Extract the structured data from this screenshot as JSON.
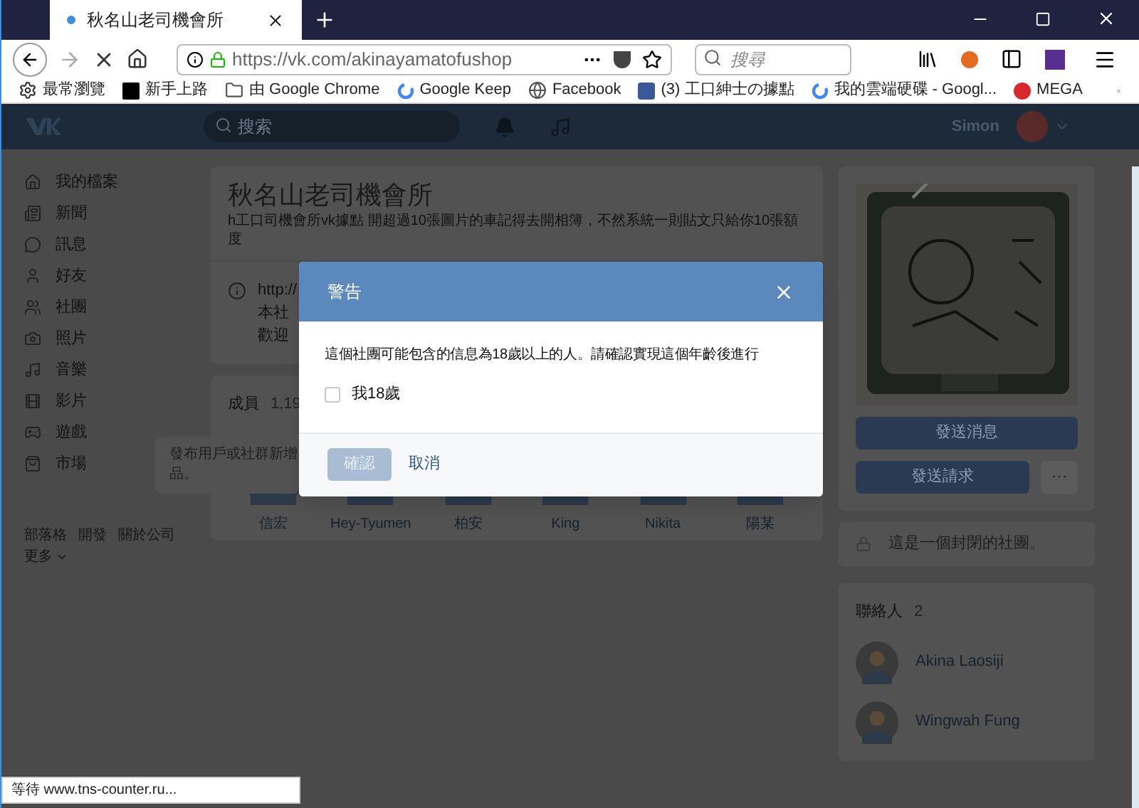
{
  "browser": {
    "tabs": [
      {
        "title": "秋名山老司機會所",
        "selected": true
      }
    ],
    "url": "https://vk.com/akinayamatofushop",
    "search": {
      "placeholder": "搜尋"
    },
    "bookmarks": [
      {
        "label": "最常瀏覽"
      },
      {
        "label": "新手上路"
      },
      {
        "label": "由 Google Chrome"
      },
      {
        "label": "Google Keep"
      },
      {
        "label": "Facebook"
      },
      {
        "label": "(3) 工口紳士の據點"
      },
      {
        "label": "我的雲端硬碟 - Googl..."
      },
      {
        "label": "MEGA"
      }
    ],
    "status": "等待 www.tns-counter.ru..."
  },
  "header": {
    "search": {
      "placeholder": "搜索"
    },
    "user": "Simon"
  },
  "sidebar": {
    "items": [
      {
        "label": "我的檔案"
      },
      {
        "label": "新聞"
      },
      {
        "label": "訊息"
      },
      {
        "label": "好友"
      },
      {
        "label": "社團"
      },
      {
        "label": "照片"
      },
      {
        "label": "音樂"
      },
      {
        "label": "影片"
      },
      {
        "label": "遊戲"
      },
      {
        "label": "市場"
      }
    ],
    "footer_links": [
      "部落格",
      "開發",
      "關於公司"
    ],
    "more": "更多"
  },
  "tooltip": {
    "lines": [
      "發布用戶或社群新增",
      "品。"
    ]
  },
  "group": {
    "title": "秋名山老司機會所",
    "description": "h工口司機會所vk據點 開超過10張圖片的車記得去開相簿，不然系統一則貼文只給你10張額度",
    "info_lines": [
      "http://",
      "本社",
      "歡迎"
    ],
    "members": {
      "label": "成員",
      "count": "1,19",
      "people": [
        {
          "name": "信宏"
        },
        {
          "name": "Hey-Tyumen"
        },
        {
          "name": "柏安"
        },
        {
          "name": "King"
        },
        {
          "name": "Nikita"
        },
        {
          "name": "陽某"
        }
      ]
    }
  },
  "right": {
    "buttons": [
      {
        "label": "發送消息"
      },
      {
        "label": "發送請求"
      },
      {
        "label": "···"
      }
    ],
    "closed_notice": "這是一個封閉的社團。",
    "contacts": {
      "label": "聯絡人",
      "count": "2",
      "people": [
        {
          "name": "Akina Laosiji"
        },
        {
          "name": "Wingwah Fung"
        }
      ]
    }
  },
  "modal": {
    "title": "警告",
    "message": "這個社團可能包含的信息為18歲以上的人。請確認實現這個年齡後進行",
    "checkbox": {
      "label": "我18歲",
      "checked": false
    },
    "confirm": {
      "label": "確認",
      "disabled": true
    },
    "cancel": "取消"
  }
}
